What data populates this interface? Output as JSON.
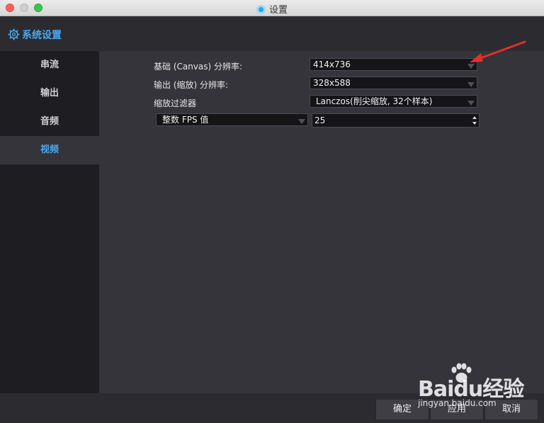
{
  "window": {
    "title": "设置"
  },
  "header": {
    "title": "系统设置"
  },
  "sidebar": {
    "items": [
      {
        "label": "串流",
        "active": false
      },
      {
        "label": "输出",
        "active": false
      },
      {
        "label": "音频",
        "active": false
      },
      {
        "label": "视频",
        "active": true
      }
    ]
  },
  "video": {
    "base_label": "基础 (Canvas) 分辨率:",
    "base_value": "414x736",
    "output_label": "输出 (缩放) 分辨率:",
    "output_value": "328x588",
    "filter_label": "缩放过滤器",
    "filter_value": "Lanczos(削尖缩放, 32个样本)",
    "fps_mode_value": "整数 FPS 值",
    "fps_value": "25"
  },
  "footer": {
    "ok_label": "确定",
    "apply_label": "应用",
    "cancel_label": "取消"
  },
  "watermark": {
    "brand": "Baidu经验",
    "url": "jingyan.baidu.com"
  },
  "colors": {
    "accent": "#4aa8f0",
    "arrow": "#e0302a"
  }
}
